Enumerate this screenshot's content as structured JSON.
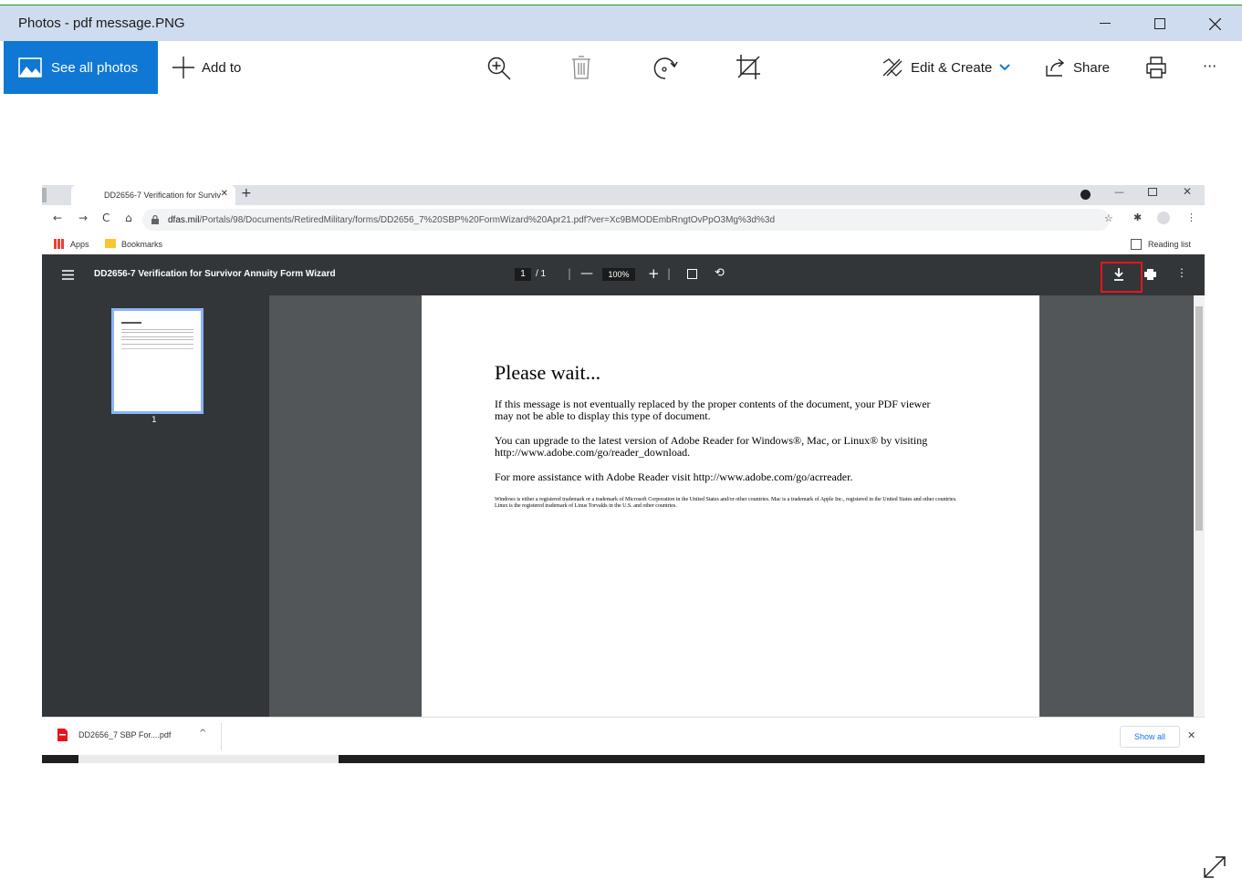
{
  "app": {
    "title": "Photos - pdf message.PNG",
    "window_controls": [
      "—",
      "☐",
      "✕"
    ],
    "see_all_label": "See all photos",
    "add_to_label": "Add to",
    "edit_create_label": "Edit & Create",
    "share_label": "Share",
    "more_label": "···",
    "accent_color": "#0f78d4"
  },
  "browser": {
    "tab_title": "DD2656-7 Verification for Surviv",
    "url_host": "dfas.mil",
    "url_path": "/Portals/98/Documents/RetiredMilitary/forms/DD2656_7%20SBP%20FormWizard%20Apr21.pdf?ver=Xc9BMODEmbRngtOvPpO3Mg%3d%3d",
    "bookmarks": [
      "Apps",
      "Bookmarks"
    ],
    "reading_list": "Reading list"
  },
  "pdf": {
    "title": "DD2656-7 Verification for Survivor Annuity Form Wizard",
    "page_current": "1",
    "page_total": "/ 1",
    "zoom": "100%",
    "thumb_label": "1",
    "heading": "Please wait...",
    "para1": "If this message is not eventually replaced by the proper contents of the document, your PDF viewer may not be able to display this type of document.",
    "para2": "You can upgrade to the latest version of Adobe Reader for Windows®, Mac, or Linux® by visiting  http://www.adobe.com/go/reader_download.",
    "para3": "For more assistance with Adobe Reader visit  http://www.adobe.com/go/acrreader.",
    "para4": "Windows is either a registered trademark or a trademark of Microsoft Corporation in the United States and/or other countries. Mac is a trademark of Apple Inc., registered in the United States and other countries. Linux is the registered trademark of Linus Torvalds in the U.S. and other countries."
  },
  "download": {
    "file": "DD2656_7 SBP For....pdf",
    "show_all": "Show all"
  },
  "highlight_color": "#e8141c"
}
